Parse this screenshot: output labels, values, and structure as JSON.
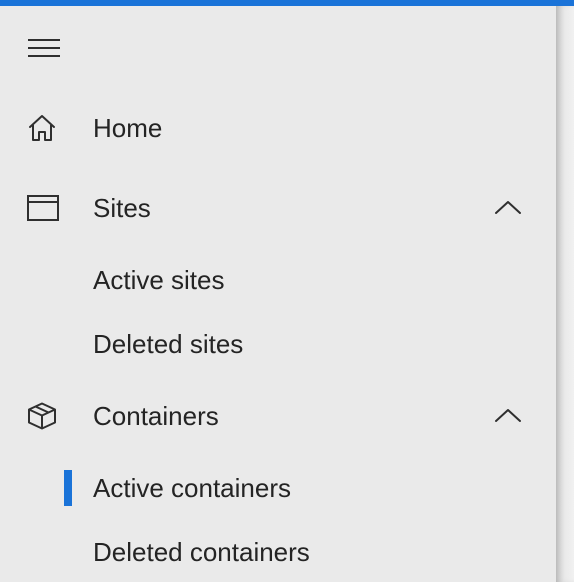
{
  "colors": {
    "accent": "#1a73d8",
    "background": "#eaeaea",
    "text": "#242424",
    "icon_stroke": "#2f2f2f"
  },
  "nav": {
    "menu_icon": "hamburger-menu-icon",
    "items": [
      {
        "label": "Home",
        "icon": "home-icon"
      },
      {
        "label": "Sites",
        "icon": "browser-window-icon",
        "expanded": true,
        "chevron": "chevron-up-icon",
        "children": [
          {
            "label": "Active sites"
          },
          {
            "label": "Deleted sites"
          }
        ]
      },
      {
        "label": "Containers",
        "icon": "cube-icon",
        "expanded": true,
        "chevron": "chevron-up-icon",
        "children": [
          {
            "label": "Active containers",
            "selected": true
          },
          {
            "label": "Deleted containers"
          }
        ]
      }
    ]
  }
}
